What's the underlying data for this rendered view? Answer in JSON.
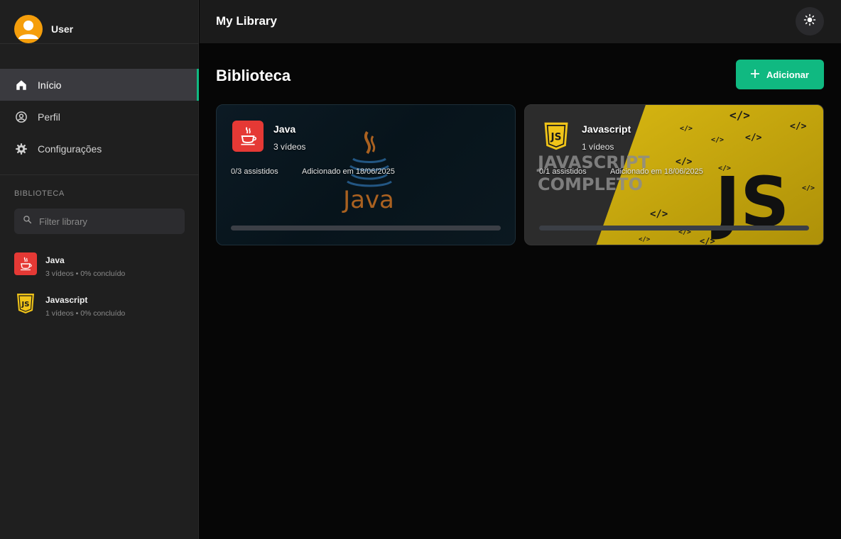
{
  "app": {
    "title": "My Library"
  },
  "user": {
    "name": "User"
  },
  "nav": {
    "items": [
      {
        "label": "Início",
        "icon": "home-icon",
        "active": true
      },
      {
        "label": "Perfil",
        "icon": "user-circle-icon",
        "active": false
      },
      {
        "label": "Configurações",
        "icon": "gear-icon",
        "active": false
      }
    ]
  },
  "library_section": {
    "label": "BIBLIOTECA",
    "filter_placeholder": "Filter library",
    "items": [
      {
        "title": "Java",
        "meta": "3 vídeos • 0% concluído",
        "icon": "java-logo-icon"
      },
      {
        "title": "Javascript",
        "meta": "1 vídeos • 0% concluído",
        "icon": "js-logo-icon"
      }
    ]
  },
  "main": {
    "title": "Biblioteca",
    "add_button": "Adicionar",
    "cards": [
      {
        "title": "Java",
        "count": "3 vídeos",
        "watched": "0/3 assistidos",
        "added": "Adicionado em 18/06/2025",
        "progress": 0,
        "cover_text": "Java"
      },
      {
        "title": "Javascript",
        "count": "1 vídeos",
        "watched": "0/1 assistidos",
        "added": "Adicionado em 18/06/2025",
        "progress": 0,
        "cover_text_1": "JAVASCRIPT",
        "cover_text_2": "COMPLETO",
        "cover_badge": "JS",
        "cover_tag": "</>"
      }
    ]
  },
  "colors": {
    "accent": "#10b981",
    "avatar": "#f59e0b",
    "java": "#e53935",
    "js": "#f0c419"
  }
}
